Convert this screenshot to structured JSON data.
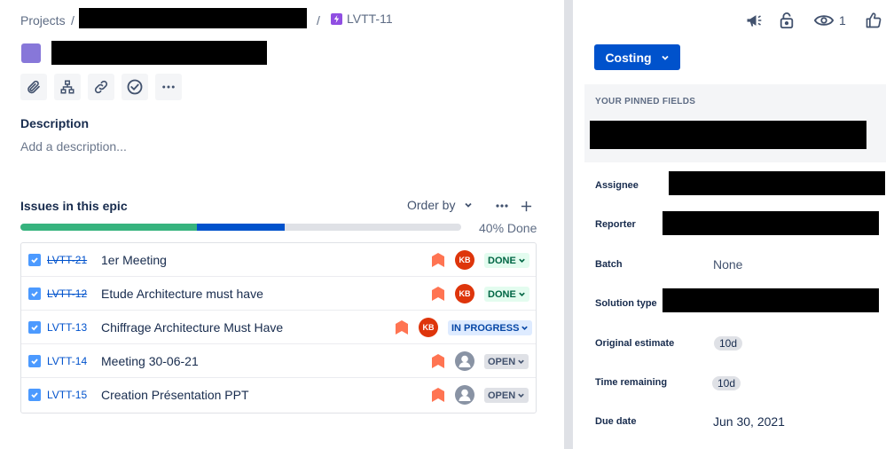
{
  "breadcrumb": {
    "projects_label": "Projects",
    "separator": "/",
    "issue_key": "LVTT-11"
  },
  "toolbar": {
    "icons": [
      "attachment-icon",
      "child-issue-icon",
      "link-icon",
      "checklist-icon",
      "more-icon"
    ]
  },
  "description": {
    "label": "Description",
    "placeholder": "Add a description..."
  },
  "epic_issues": {
    "title": "Issues in this epic",
    "order_by_label": "Order by",
    "progress_label": "40% Done",
    "progress": {
      "done": 0.4,
      "in_progress": 0.2,
      "done_color": "#36B37E",
      "in_progress_color": "#0052CC",
      "todo_color": "#DFE1E6"
    },
    "issues": [
      {
        "key": "LVTT-21",
        "summary": "1er Meeting",
        "assignee_initials": "KB",
        "status": "DONE",
        "resolved": true
      },
      {
        "key": "LVTT-12",
        "summary": "Etude Architecture must have",
        "assignee_initials": "KB",
        "status": "DONE",
        "resolved": true
      },
      {
        "key": "LVTT-13",
        "summary": "Chiffrage Architecture Must Have",
        "assignee_initials": "KB",
        "status": "IN PROGRESS",
        "resolved": false
      },
      {
        "key": "LVTT-14",
        "summary": "Meeting 30-06-21",
        "assignee_initials": "",
        "status": "OPEN",
        "resolved": false
      },
      {
        "key": "LVTT-15",
        "summary": "Creation Présentation PPT",
        "assignee_initials": "",
        "status": "OPEN",
        "resolved": false
      }
    ]
  },
  "header_actions": {
    "watch_count": "1",
    "icons": [
      "feedback-megaphone-icon",
      "unlock-icon",
      "watch-eye-icon",
      "like-thumb-icon"
    ]
  },
  "status_button": {
    "label": "Costing"
  },
  "pinned": {
    "label": "YOUR PINNED FIELDS"
  },
  "fields": {
    "assignee_label": "Assignee",
    "reporter_label": "Reporter",
    "batch_label": "Batch",
    "batch_value": "None",
    "solution_type_label": "Solution type",
    "original_estimate_label": "Original estimate",
    "original_estimate_value": "10d",
    "time_remaining_label": "Time remaining",
    "time_remaining_value": "10d",
    "due_date_label": "Due date",
    "due_date_value": "Jun 30, 2021"
  },
  "colors": {
    "accent": "#0052CC",
    "epic": "#8777D9",
    "priority": "#FF7452",
    "avatar_kb": "#DE350B"
  }
}
